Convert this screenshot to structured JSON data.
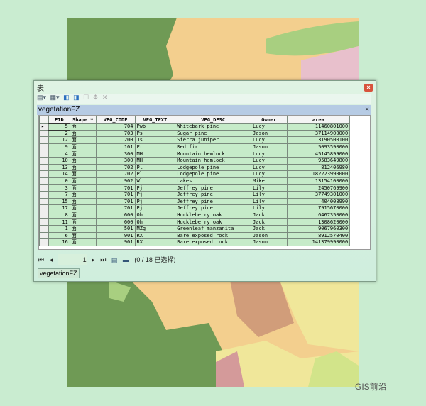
{
  "window": {
    "title": "表",
    "close": "×"
  },
  "toolbar": {
    "icons": [
      "table-options-icon",
      "related-tables-icon",
      "select-by-attributes-icon",
      "switch-selection-icon",
      "clear-selection-icon",
      "zoom-selected-icon",
      "delete-selected-icon"
    ]
  },
  "table_tab": {
    "name": "vegetationFZ",
    "close": "×"
  },
  "columns": [
    "FID",
    "Shape *",
    "VEG_CODE",
    "VEG_TEXT",
    "VEG_DESC",
    "Owner",
    "area"
  ],
  "rows": [
    [
      "5",
      "面",
      "704",
      "Pwb",
      "Whitebark pine",
      "Lucy",
      "11460801000"
    ],
    [
      "2",
      "面",
      "703",
      "Ps",
      "Sugar pine",
      "Jason",
      "37114900000"
    ],
    [
      "12",
      "面",
      "200",
      "Js",
      "Sierra juniper",
      "Lucy",
      "3190500100"
    ],
    [
      "9",
      "面",
      "101",
      "Fr",
      "Red fir",
      "Jason",
      "5093590000"
    ],
    [
      "4",
      "面",
      "300",
      "MH",
      "Mountain hemlock",
      "Lucy",
      "45145899000"
    ],
    [
      "10",
      "面",
      "300",
      "MH",
      "Mountain hemlock",
      "Lucy",
      "9583649800"
    ],
    [
      "13",
      "面",
      "702",
      "Pl",
      "Lodgepole pine",
      "Lucy",
      "812406980"
    ],
    [
      "14",
      "面",
      "702",
      "Pl",
      "Lodgepole pine",
      "Lucy",
      "182223990000"
    ],
    [
      "0",
      "面",
      "902",
      "Wl",
      "Lakes",
      "Mike",
      "13154100000"
    ],
    [
      "3",
      "面",
      "701",
      "Pj",
      "Jeffrey pine",
      "Lily",
      "2450769900"
    ],
    [
      "7",
      "面",
      "701",
      "Pj",
      "Jeffrey pine",
      "Lily",
      "37749301000"
    ],
    [
      "15",
      "面",
      "701",
      "Pj",
      "Jeffrey pine",
      "Lily",
      "404008990"
    ],
    [
      "17",
      "面",
      "701",
      "Pj",
      "Jeffrey pine",
      "Lily",
      "7915670000"
    ],
    [
      "8",
      "面",
      "600",
      "Oh",
      "Huckleberry oak",
      "Jack",
      "6467350000"
    ],
    [
      "11",
      "面",
      "600",
      "Oh",
      "Huckleberry oak",
      "Jack",
      "1308620000"
    ],
    [
      "1",
      "面",
      "501",
      "MZg",
      "Greenleaf manzanita",
      "Jack",
      "9067960300"
    ],
    [
      "6",
      "面",
      "901",
      "RX",
      "Bare exposed rock",
      "Jason",
      "8912570400"
    ],
    [
      "16",
      "面",
      "901",
      "RX",
      "Bare exposed rock",
      "Jason",
      "141379990000"
    ]
  ],
  "navigation": {
    "first": "⏮",
    "prev": "◂",
    "page": "1",
    "next": "▸",
    "last": "⏭",
    "status": "(0 / 18 已选择)"
  },
  "bottom_tab": "vegetationFZ",
  "watermark": "GIS前沿"
}
